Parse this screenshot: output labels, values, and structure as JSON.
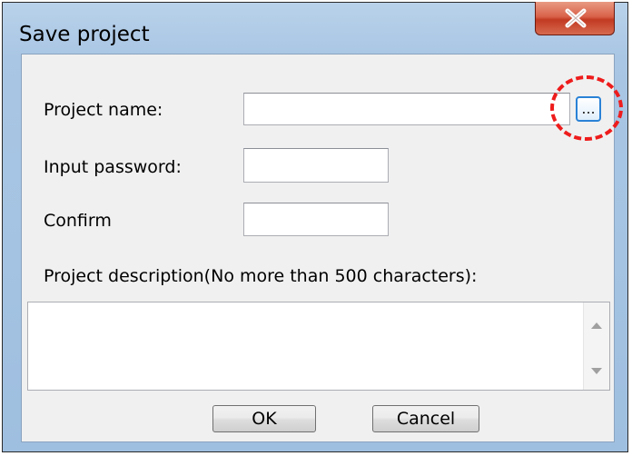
{
  "window": {
    "title": "Save project",
    "close_icon": "close-x-icon"
  },
  "form": {
    "project_name_label": "Project name:",
    "project_name_value": "",
    "browse_button_label": "...",
    "password_label": "Input password:",
    "password_value": "",
    "confirm_label": "Confirm",
    "confirm_value": "",
    "description_label": "Project description(No more than 500 characters):",
    "description_value": ""
  },
  "buttons": {
    "ok_label": "OK",
    "cancel_label": "Cancel"
  },
  "colors": {
    "highlight_ring": "#ee1c1c",
    "close_button": "#c23a22",
    "browse_border": "#2a82d6"
  }
}
